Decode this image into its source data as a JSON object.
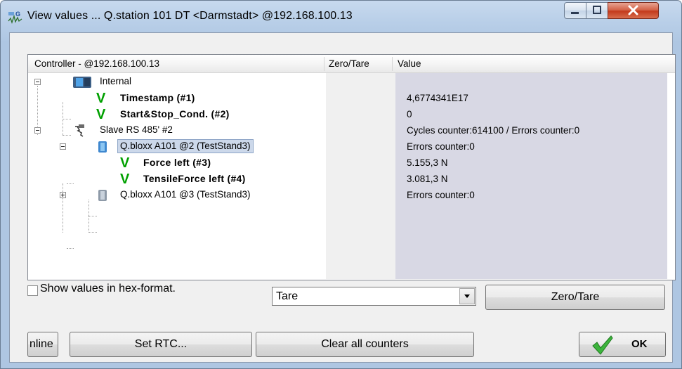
{
  "window": {
    "title": "View values ...  Q.station 101 DT  <Darmstadt>  @192.168.100.13",
    "minimize_icon": "minimize-icon",
    "maximize_icon": "maximize-icon",
    "close_icon": "close-icon"
  },
  "tree": {
    "columns": {
      "controller": "Controller - @192.168.100.13",
      "zero_tare": "Zero/Tare",
      "value": "Value"
    },
    "rows": [
      {
        "label": "Internal",
        "value": "",
        "icon": "internal-device-icon"
      },
      {
        "label": "Timestamp (#1)",
        "value": "4,6774341E17",
        "icon": "check-icon"
      },
      {
        "label": "Start&Stop_Cond. (#2)",
        "value": "0",
        "icon": "check-icon"
      },
      {
        "label": "Slave RS 485' #2",
        "value": "Cycles counter:614100 / Errors counter:0",
        "icon": "cable-icon"
      },
      {
        "label": "Q.bloxx A101 @2 (TestStand3)",
        "value": "Errors counter:0",
        "icon": "module-icon"
      },
      {
        "label": "Force left (#3)",
        "value": "5.155,3 N",
        "icon": "check-icon"
      },
      {
        "label": "TensileForce left (#4)",
        "value": "3.081,3 N",
        "icon": "check-icon"
      },
      {
        "label": "Q.bloxx A101 @3 (TestStand3)",
        "value": "Errors counter:0",
        "icon": "module-icon"
      }
    ],
    "check_mark": "V"
  },
  "options": {
    "hex_label": "Show values in hex-format.",
    "hex_checked": false,
    "combo_value": "Tare",
    "zero_tare_button": "Zero/Tare"
  },
  "buttons": {
    "online": "nline",
    "set_rtc": "Set RTC...",
    "clear_counters": "Clear all counters",
    "ok": "OK"
  },
  "colors": {
    "check_green": "#00a000",
    "selection_bg": "#ccd8ea",
    "value_column_bg": "#d8d8e4"
  }
}
